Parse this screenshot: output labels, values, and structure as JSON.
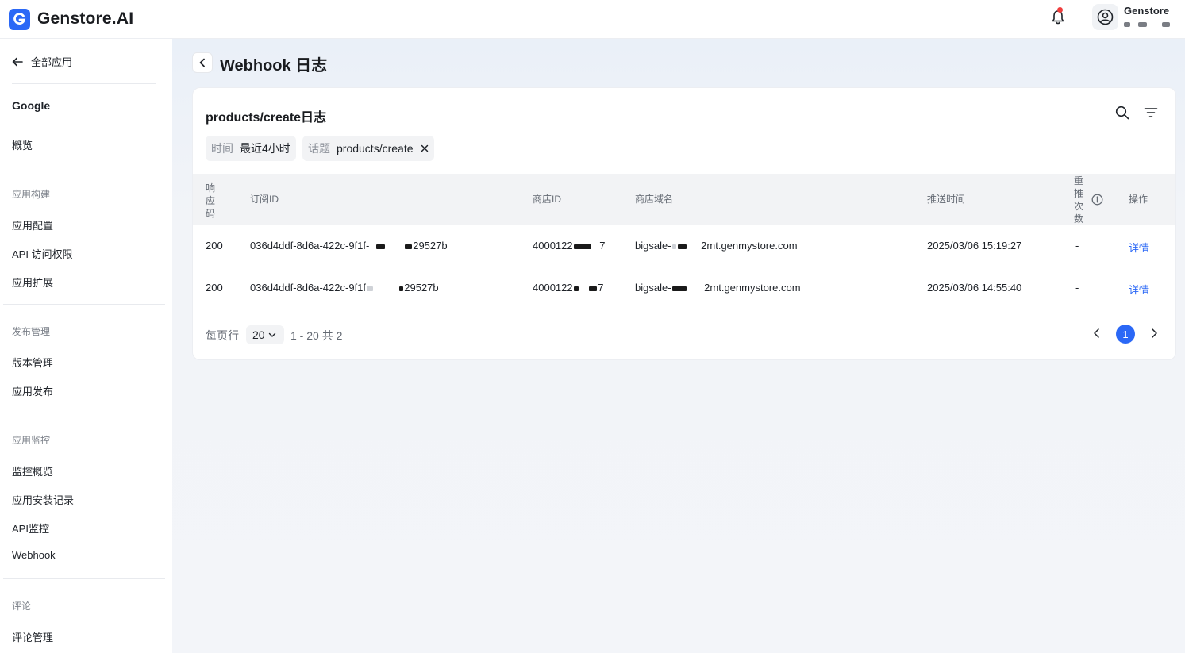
{
  "app": {
    "name": "Genstore.AI"
  },
  "user": {
    "name": "Genstore"
  },
  "sidebar": {
    "back_label": "全部应用",
    "app_name": "Google",
    "overview": "概览",
    "groups": [
      {
        "title": "应用构建",
        "items": [
          "应用配置",
          "API 访问权限",
          "应用扩展"
        ]
      },
      {
        "title": "发布管理",
        "items": [
          "版本管理",
          "应用发布"
        ]
      },
      {
        "title": "应用监控",
        "items": [
          "监控概览",
          "应用安装记录",
          "API监控",
          "Webhook"
        ]
      },
      {
        "title": "评论",
        "items": [
          "评论管理"
        ]
      }
    ]
  },
  "page": {
    "title": "Webhook 日志"
  },
  "card": {
    "title": "products/create日志",
    "filters": [
      {
        "key": "时间",
        "value": "最近4小时"
      },
      {
        "key": "话题",
        "value": "products/create"
      }
    ]
  },
  "table": {
    "columns": [
      "响应码",
      "订阅ID",
      "商店ID",
      "商店域名",
      "推送时间",
      "重推次数",
      "操作"
    ],
    "rows": [
      {
        "code": "200",
        "sub_id_prefix": "036d4ddf-8d6a-422c-9f1f-",
        "sub_id_suffix": "29527b",
        "shop_id_prefix": "4000122",
        "shop_id_suffix": "7",
        "domain_prefix": "bigsale-",
        "domain_suffix": "2mt.genmystore.com",
        "time": "2025/03/06 15:19:27",
        "retries": "-",
        "action": "详情"
      },
      {
        "code": "200",
        "sub_id_prefix": "036d4ddf-8d6a-422c-9f1f",
        "sub_id_suffix": "29527b",
        "shop_id_prefix": "4000122",
        "shop_id_suffix": "7",
        "domain_prefix": "bigsale-",
        "domain_suffix": "2mt.genmystore.com",
        "time": "2025/03/06 14:55:40",
        "retries": "-",
        "action": "详情"
      }
    ]
  },
  "pagination": {
    "per_page_label": "每页行",
    "per_page": "20",
    "range": "1 - 20 共 2",
    "current_page": "1"
  },
  "colors": {
    "accent": "#2b68f6",
    "notification": "#f03d3d"
  }
}
